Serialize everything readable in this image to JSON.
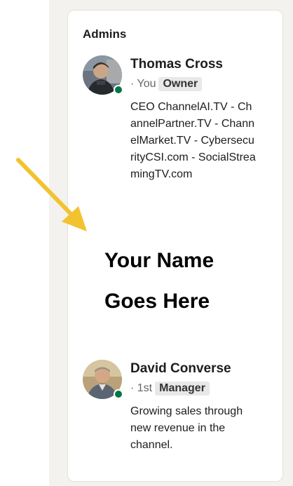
{
  "section_title": "Admins",
  "admins": [
    {
      "name": "Thomas Cross",
      "connection": "· You",
      "badge": "Owner",
      "headline": "CEO ChannelAI.TV - ChannelPartner.TV - ChannelMarket.TV - CybersecurityCSI.com - SocialStreamingTV.com"
    },
    {
      "name": "David Converse",
      "connection": "· 1st",
      "badge": "Manager",
      "headline": "Growing sales through new revenue in the channel."
    }
  ],
  "placeholder": {
    "line1": "Your Name",
    "line2": "Goes Here"
  },
  "colors": {
    "online_status": "#057642",
    "arrow": "#f2c230",
    "sidebar_background": "#f4f2ee"
  },
  "icons": {
    "pointer_arrow": "arrow-icon",
    "status": "online-status-dot"
  }
}
